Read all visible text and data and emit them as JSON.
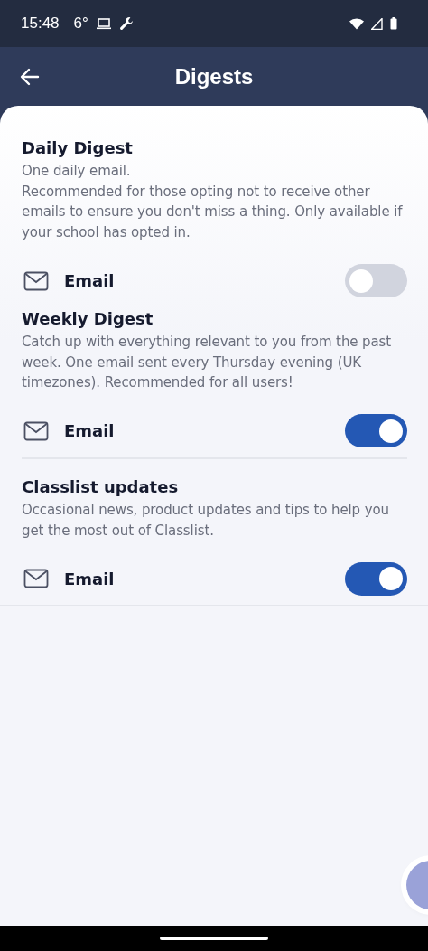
{
  "status_bar": {
    "time": "15:48",
    "temperature": "6°"
  },
  "header": {
    "title": "Digests"
  },
  "sections": [
    {
      "title": "Daily Digest",
      "description": "One daily email.\nRecommended for those opting not to receive other emails to ensure you don't miss a thing. Only available if your school has opted in.",
      "option": {
        "label": "Email",
        "on": false
      },
      "divider_below": false
    },
    {
      "title": "Weekly Digest",
      "description": "Catch up with everything relevant to you from the past week. One email sent every Thursday evening (UK timezones). Recommended for all users!",
      "option": {
        "label": "Email",
        "on": true
      },
      "divider_below": true
    },
    {
      "title": "Classlist updates",
      "description": "Occasional news, product updates and tips to help you get the most out of Classlist.",
      "option": {
        "label": "Email",
        "on": true
      },
      "divider_below": true
    }
  ]
}
